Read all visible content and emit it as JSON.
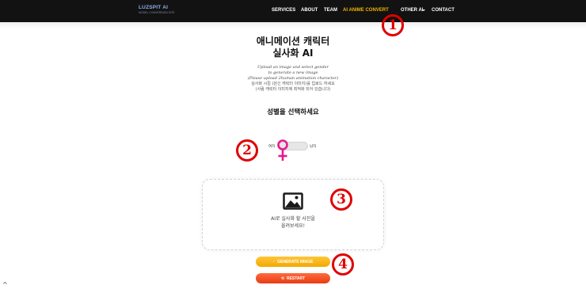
{
  "brand": {
    "name": "LUZSPIT AI",
    "tagline": "MODEL CONVERSION SITE"
  },
  "nav": {
    "items": [
      {
        "label": "SERVICES"
      },
      {
        "label": "ABOUT"
      },
      {
        "label": "TEAM"
      },
      {
        "label": "AI ANIME CONVERT",
        "active": true
      },
      {
        "label": "OTHER AI"
      },
      {
        "label": "CONTACT"
      }
    ]
  },
  "main": {
    "title_line1": "애니메이션 캐릭터",
    "title_line2": "실사화 AI",
    "desc_en": [
      "Upload an image and select gender",
      "to generate a new image",
      "(Please upload 2human animation character)"
    ],
    "desc_ko": [
      "실사화 시킬 (원신 캐릭터 이미지)를 업로드 하세요",
      "(사람 캐릭터 이미지에 최적화 되어 있습니다)"
    ],
    "gender_title": "성별을 선택하세요"
  },
  "gender_toggle": {
    "left_label": "여자",
    "right_label": "남자",
    "selected": "female"
  },
  "upload": {
    "line1": "AI로 실사화 할 사진을",
    "line2": "올려보세요!"
  },
  "buttons": {
    "generate": "GENERATE IMAGE",
    "restart": "RESTART"
  },
  "annotations": {
    "a1": "1",
    "a2": "2",
    "a3": "3",
    "a4": "4"
  },
  "colors": {
    "nav_bg": "#121212",
    "nav_active": "#f0b400",
    "generate": "#f7b500",
    "restart": "#ee4a1a",
    "female_symbol": "#e61a8c",
    "annotation": "#e00000"
  }
}
